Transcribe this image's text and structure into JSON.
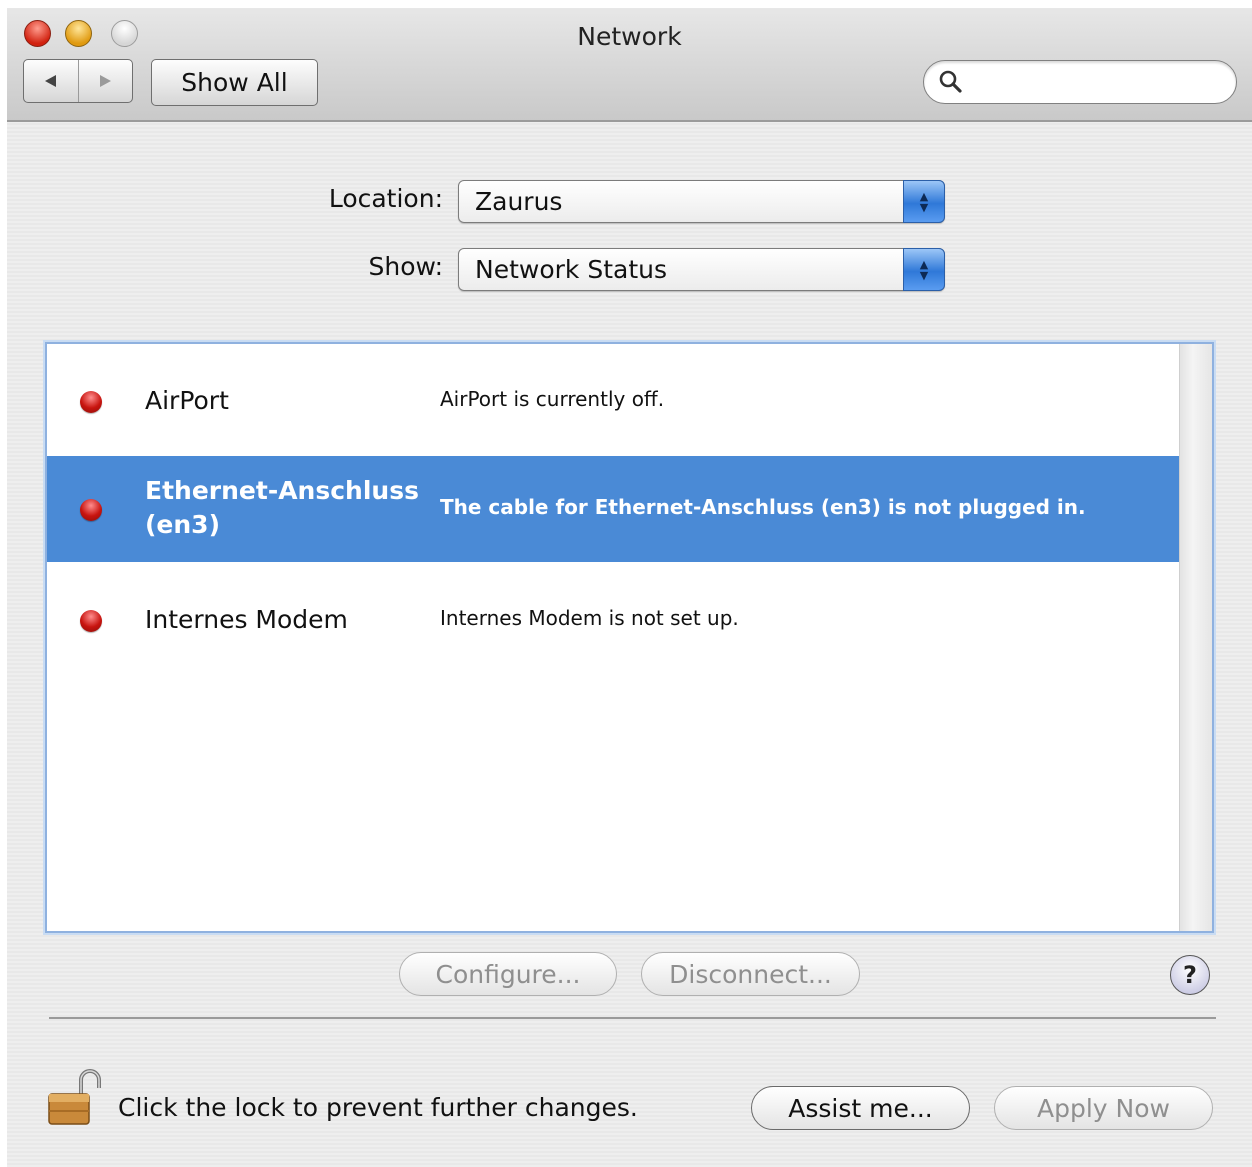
{
  "window": {
    "title": "Network"
  },
  "toolbar": {
    "back_icon": "back-arrow-icon",
    "forward_icon": "forward-arrow-icon",
    "show_all_label": "Show All",
    "search_placeholder": "",
    "search_value": ""
  },
  "location": {
    "label": "Location:",
    "value": "Zaurus"
  },
  "show": {
    "label": "Show:",
    "value": "Network Status"
  },
  "services": [
    {
      "name": "AirPort",
      "status": "AirPort is currently off.",
      "state_color": "#c8140f"
    },
    {
      "name": "Ethernet-Anschluss (en3)",
      "status": "The cable for Ethernet-Anschluss (en3) is not plugged in.",
      "state_color": "#c8140f",
      "selected": true
    },
    {
      "name": "Internes Modem",
      "status": "Internes Modem is not set up.",
      "state_color": "#c8140f"
    }
  ],
  "actions": {
    "configure_label": "Configure...",
    "disconnect_label": "Disconnect...",
    "help_label": "?"
  },
  "footer": {
    "lock_message": "Click the lock to prevent further changes.",
    "assist_label": "Assist me...",
    "apply_label": "Apply Now"
  },
  "colors": {
    "selection": "#4a8ad6",
    "status_red": "#c8140f",
    "popup_blue": "#2f78d8"
  }
}
